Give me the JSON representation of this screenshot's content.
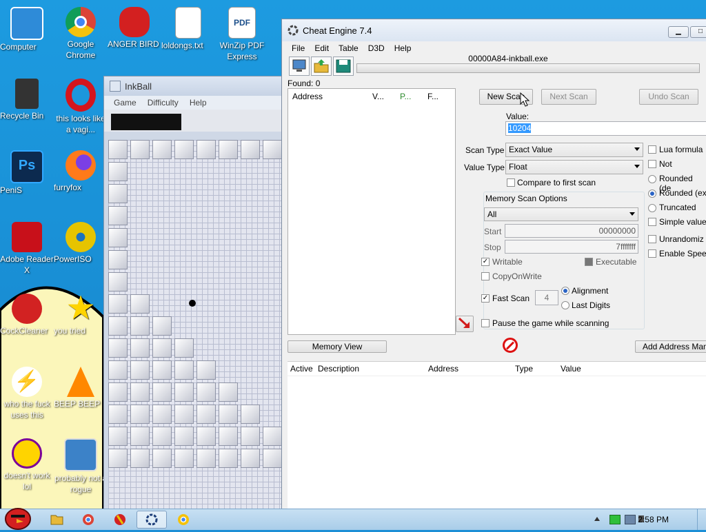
{
  "desktop_icons": [
    {
      "label": "Computer",
      "icon": "computer-icon",
      "color": "#2e8bd8"
    },
    {
      "label": "Google Chrome",
      "icon": "chrome-icon",
      "color": "#e23b2f"
    },
    {
      "label": "ANGER BIRD",
      "icon": "angry-bird-icon",
      "color": "#d32020"
    },
    {
      "label": "loldongs.txt",
      "icon": "text-file-icon",
      "color": "#ffffff"
    },
    {
      "label": "WinZip PDF Express",
      "icon": "pdf-icon",
      "color": "#ffffff"
    },
    {
      "label": "Recycle Bin",
      "icon": "recycle-bin-icon",
      "color": "#333333"
    },
    {
      "label": "this looks like a vagi...",
      "icon": "opera-icon",
      "color": "#d4151d"
    },
    {
      "label": "PeniS",
      "icon": "photoshop-icon",
      "color": "#0c2a4f"
    },
    {
      "label": "furryfox",
      "icon": "firefox-icon",
      "color": "#ff7a1a"
    },
    {
      "label": "Adobe Reader X",
      "icon": "adobe-reader-icon",
      "color": "#c8101a"
    },
    {
      "label": "PowerISO",
      "icon": "poweriso-icon",
      "color": "#e6c400"
    },
    {
      "label": "CockCleaner",
      "icon": "ccleaner-icon",
      "color": "#d22222"
    },
    {
      "label": "you tried",
      "icon": "star-icon",
      "color": "#ffd400"
    },
    {
      "label": "who the fuck uses this",
      "icon": "winamp-icon",
      "color": "#f05a12"
    },
    {
      "label": "BEEP BEEP",
      "icon": "vlc-icon",
      "color": "#ff8800"
    },
    {
      "label": "doesn't work lol",
      "icon": "yahoo-messenger-icon",
      "color": "#7b0099"
    },
    {
      "label": "probably not a rogue",
      "icon": "settings-program-icon",
      "color": "#3c82c8"
    }
  ],
  "inkball": {
    "title": "InkBall",
    "menu": [
      "Game",
      "Difficulty",
      "Help"
    ]
  },
  "cheat_engine": {
    "title": "Cheat Engine 7.4",
    "menu": [
      "File",
      "Edit",
      "Table",
      "D3D",
      "Help"
    ],
    "process": "00000A84-inkball.exe",
    "found": "Found: 0",
    "address_columns": [
      "Address",
      "V...",
      "P...",
      "F..."
    ],
    "new_scan": "New Scan",
    "next_scan": "Next Scan",
    "undo_scan": "Undo Scan",
    "value_label": "Value:",
    "value": "10204",
    "scan_type_label": "Scan Type",
    "scan_type": "Exact Value",
    "value_type_label": "Value Type",
    "value_type": "Float",
    "compare_first": "Compare to first scan",
    "lua_formula": "Lua formula",
    "not_label": "Not",
    "rounded_default": "Rounded (de",
    "rounded_extreme": "Rounded (ex",
    "truncated": "Truncated",
    "simple_values": "Simple value",
    "unrandomizer": "Unrandomiz",
    "enable_speedhack": "Enable Spee",
    "memory_scan_options": "Memory Scan Options",
    "region": "All",
    "start_label": "Start",
    "start_value": "00000000",
    "stop_label": "Stop",
    "stop_value": "7fffffff",
    "writable": "Writable",
    "executable": "Executable",
    "copy_on_write": "CopyOnWrite",
    "fast_scan": "Fast Scan",
    "fast_scan_value": "4",
    "alignment": "Alignment",
    "last_digits": "Last Digits",
    "pause_game": "Pause the game while scanning",
    "memory_view": "Memory View",
    "add_address": "Add Address Man",
    "result_columns": [
      "Active",
      "Description",
      "Address",
      "Type",
      "Value"
    ]
  },
  "taskbar": {
    "clock": "2:58 PM"
  }
}
